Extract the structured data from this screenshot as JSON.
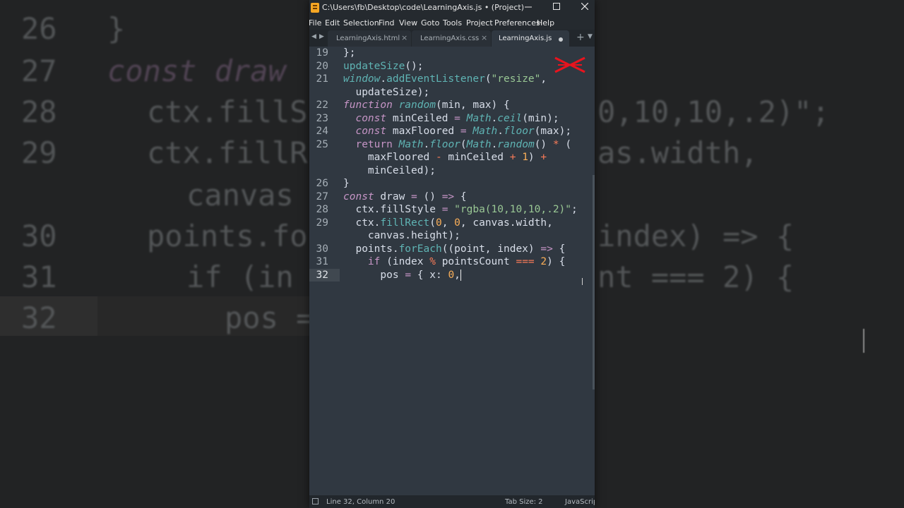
{
  "window": {
    "title": "C:\\Users\\fb\\Desktop\\code\\LearningAxis.js • (Project) - Subli...",
    "minimize_icon": "minimize-icon",
    "maximize_icon": "maximize-icon",
    "close_icon": "close-icon"
  },
  "menu": [
    "File",
    "Edit",
    "Selection",
    "Find",
    "View",
    "Goto",
    "Tools",
    "Project",
    "Preferences",
    "Help"
  ],
  "tabs": [
    {
      "label": "LearningAxis.html",
      "state": "close"
    },
    {
      "label": "LearningAxis.css",
      "state": "close"
    },
    {
      "label": "LearningAxis.js",
      "state": "modified"
    }
  ],
  "editor": {
    "lines": [
      {
        "num": "19",
        "html": "};"
      },
      {
        "num": "20",
        "html": "updateSize();"
      },
      {
        "num": "21",
        "html": "window.addEventListener(\"resize\","
      },
      {
        "num": "",
        "html": "  updateSize);"
      },
      {
        "num": "22",
        "html": "function random(min, max) {"
      },
      {
        "num": "23",
        "html": "  const minCeiled = Math.ceil(min);"
      },
      {
        "num": "24",
        "html": "  const maxFloored = Math.floor(max);"
      },
      {
        "num": "25",
        "html": "  return Math.floor(Math.random() * ("
      },
      {
        "num": "",
        "html": "    maxFloored - minCeiled + 1) +"
      },
      {
        "num": "",
        "html": "    minCeiled);"
      },
      {
        "num": "26",
        "html": "}"
      },
      {
        "num": "27",
        "html": "const draw = () => {"
      },
      {
        "num": "28",
        "html": "  ctx.fillStyle = \"rgba(10,10,10,.2)\";"
      },
      {
        "num": "29",
        "html": "  ctx.fillRect(0, 0, canvas.width,"
      },
      {
        "num": "",
        "html": "    canvas.height);"
      },
      {
        "num": "30",
        "html": "  points.forEach((point, index) => {"
      },
      {
        "num": "31",
        "html": "    if (index % pointsCount === 2) {"
      },
      {
        "num": "32",
        "html": "      pos = { x: 0,"
      }
    ],
    "current_line": "32"
  },
  "status": {
    "position": "Line 32, Column 20",
    "tab_size": "Tab Size: 2",
    "syntax": "JavaScript"
  },
  "background": {
    "lines": [
      {
        "num": "26",
        "code": "}"
      },
      {
        "num": "27",
        "code": "const draw"
      },
      {
        "num": "28",
        "code": "ctx.fillS"
      },
      {
        "num": "29",
        "code": "ctx.fillR"
      },
      {
        "num": "",
        "code": "canvas"
      },
      {
        "num": "30",
        "code": "points.fo"
      },
      {
        "num": "31",
        "code": "if (in"
      },
      {
        "num": "32",
        "code": "pos ="
      }
    ],
    "right_lines": [
      "0,10,10,.2)\";",
      "as.width,",
      "index) => {",
      "nt === 2) {"
    ]
  },
  "colors": {
    "editor_bg": "#303841",
    "keyword": "#c695c6",
    "function": "#5fb4b4",
    "string": "#99c794",
    "number": "#f9ae58",
    "operator": "#f97b58",
    "logo_red": "#e8141e"
  }
}
